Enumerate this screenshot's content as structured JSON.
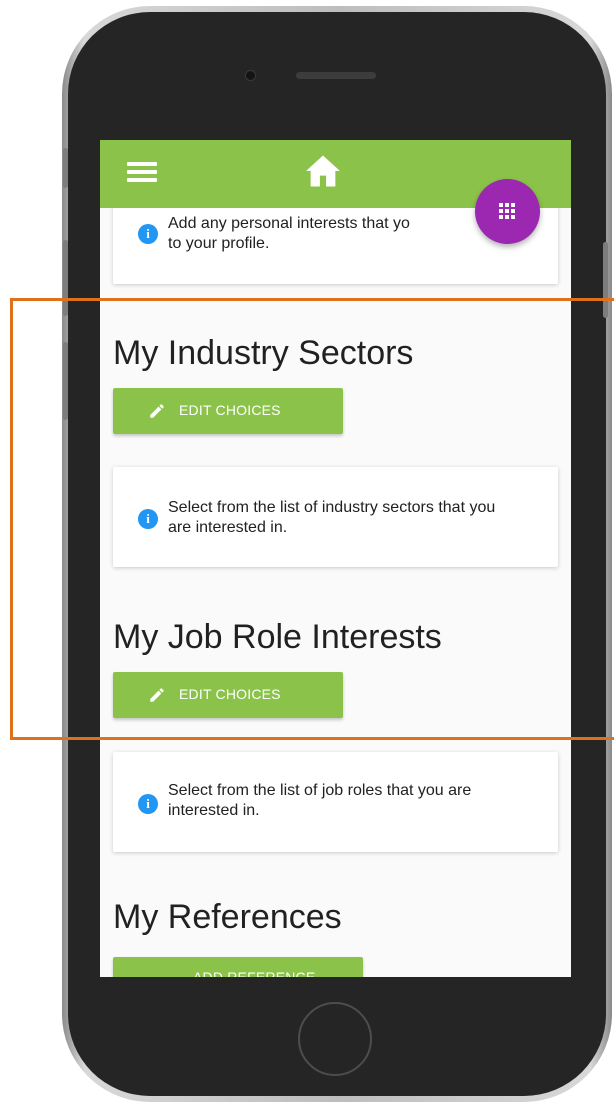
{
  "appbar": {
    "menu_icon": "hamburger-menu-icon",
    "home_icon": "home-icon",
    "fab_icon": "apps-grid-icon",
    "color": "#8bc34a",
    "fab_color": "#9c27b0"
  },
  "personal_interests": {
    "info_text": "Add any personal interests that you would like to add to your profile.",
    "visible_text_line1": "Add any personal interests that yo",
    "visible_text_line2": "to your profile."
  },
  "industry_sectors": {
    "title": "My Industry Sectors",
    "button_label": "EDIT CHOICES",
    "info_text": "Select from the list of industry sectors that you are interested in."
  },
  "job_roles": {
    "title": "My Job Role Interests",
    "button_label": "EDIT CHOICES",
    "info_text": "Select from the list of job roles that you are interested in."
  },
  "references": {
    "title": "My References",
    "button_label": "ADD REFERENCE"
  },
  "info_icon_glyph": "i"
}
